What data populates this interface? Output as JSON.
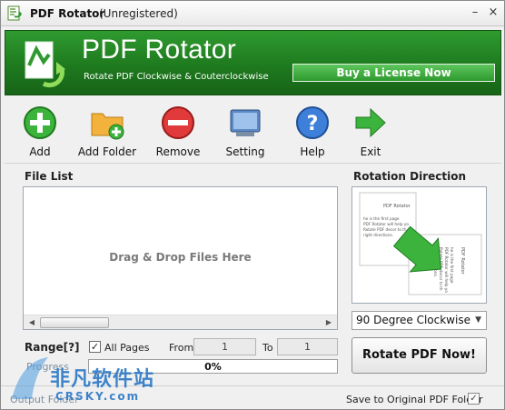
{
  "window": {
    "title": "PDF Rotator",
    "subtitle": "(Unregistered)",
    "minimize_glyph": "–",
    "close_glyph": "×"
  },
  "header": {
    "brand_title": "PDF Rotator",
    "brand_subtitle": "Rotate PDF Clockwise & Couterclockwise",
    "buy_label": "Buy a License Now",
    "accent_color": "#1e7a1e"
  },
  "toolbar": {
    "items": [
      {
        "label": "Add",
        "icon": "plus-circle-icon"
      },
      {
        "label": "Add Folder",
        "icon": "folder-add-icon"
      },
      {
        "label": "Remove",
        "icon": "minus-circle-icon"
      },
      {
        "label": "Setting",
        "icon": "settings-monitor-icon"
      },
      {
        "label": "Help",
        "icon": "help-question-icon"
      },
      {
        "label": "Exit",
        "icon": "exit-arrow-icon"
      }
    ]
  },
  "file_list": {
    "label": "File List",
    "drop_hint": "Drag & Drop Files Here"
  },
  "range": {
    "label": "Range[?]",
    "all_pages_label": "All Pages",
    "all_pages_checked": true,
    "check_glyph": "✓",
    "from_label": "From",
    "from_value": "1",
    "to_label": "To",
    "to_value": "1"
  },
  "progress": {
    "label": "Progress",
    "value_text": "0%",
    "value": 0
  },
  "rotation": {
    "label": "Rotation Direction",
    "preview_doc_title": "PDF Rotator",
    "preview_lines": [
      "he is the first page",
      "PDF Rotator will help yo",
      "Rotate PDF decor to th",
      "right directions."
    ],
    "selected": "90 Degree Clockwise",
    "rotate_button": "Rotate PDF Now!"
  },
  "status": {
    "left_text": "Output Folder",
    "save_original_label": "Save to Original PDF Folder",
    "save_original_checked": true
  },
  "watermark": {
    "cn_text": "非凡软件站",
    "en_text": "CRSKY.com"
  }
}
